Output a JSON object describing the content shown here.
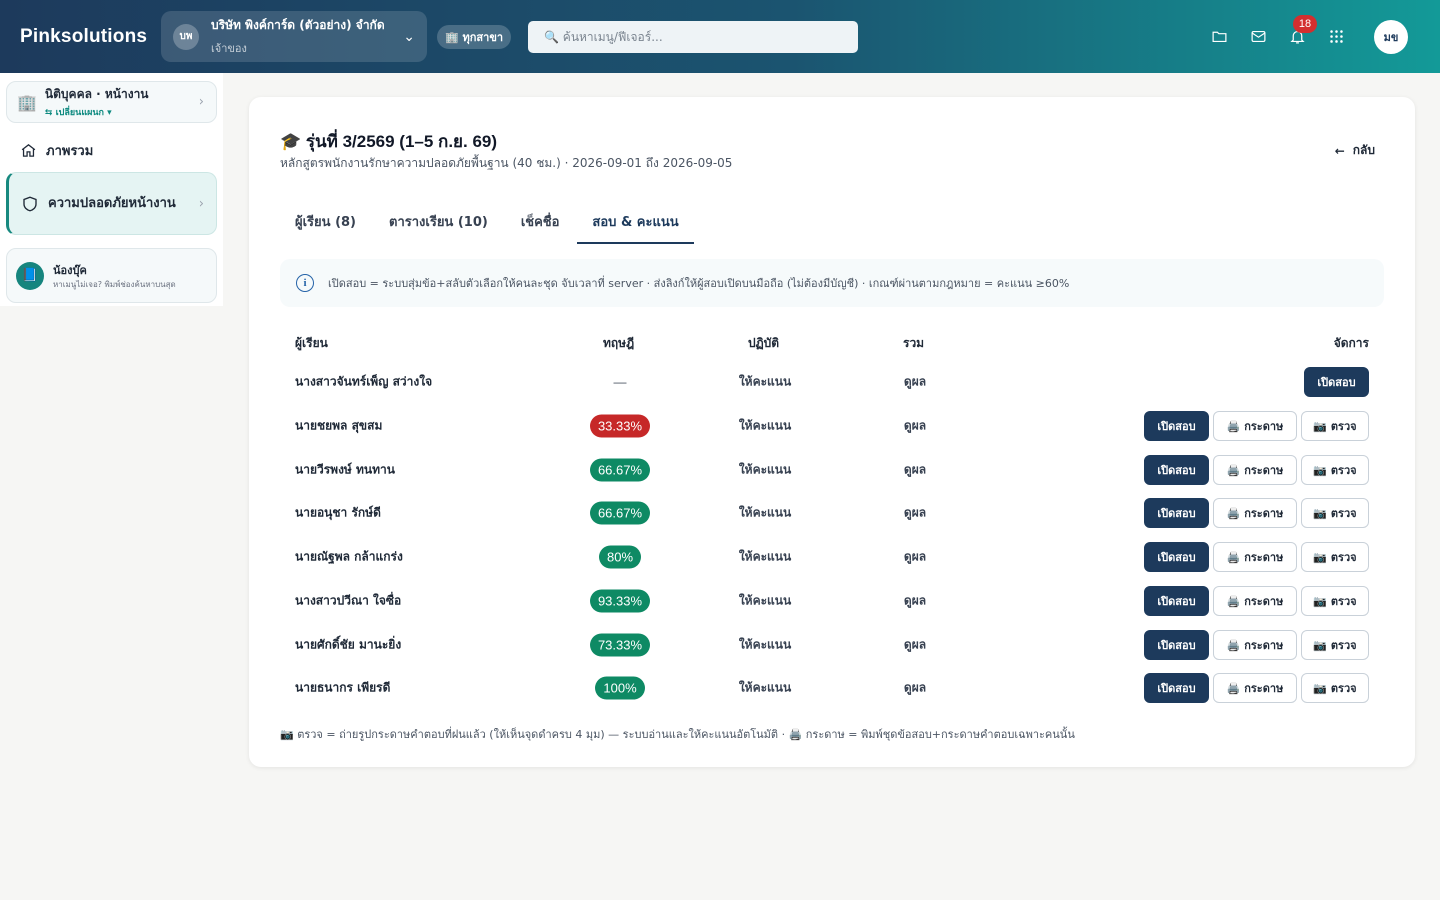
{
  "header": {
    "brand": "Pinksolutions",
    "company_initials": "บพ",
    "company_name": "บริษัท พิงค์การ์ด (ตัวอย่าง) จำกัด",
    "company_role": "เจ้าของ",
    "branch_label": "🏢 ทุกสาขา",
    "search_placeholder": "🔍 ค้นหาเมนู/ฟีเจอร์...",
    "notification_count": "18",
    "user_initials": "มข"
  },
  "sidebar": {
    "org_title": "นิติบุคคล · หน้างาน",
    "org_sub": "⇆ เปลี่ยนแผนก ▾",
    "home_label": "ภาพรวม",
    "active_item": "ความปลอดภัยหน้างาน",
    "helper_title": "น้องบุ๊ค",
    "helper_sub": "หาเมนูไม่เจอ? พิมพ์ช่องค้นหาบนสุด"
  },
  "course": {
    "title": "🎓 รุ่นที่ 3/2569 (1–5 ก.ย. 69)",
    "subtitle": "หลักสูตรพนักงานรักษาความปลอดภัยพื้นฐาน (40 ชม.) · 2026-09-01 ถึง 2026-09-05",
    "back_label": "กลับ"
  },
  "tabs": [
    "ผู้เรียน (8)",
    "ตารางเรียน (10)",
    "เช็คชื่อ",
    "สอบ & คะแนน"
  ],
  "active_tab": 3,
  "info_text": "เปิดสอบ = ระบบสุ่มข้อ+สลับตัวเลือกให้คนละชุด จับเวลาที่ server · ส่งลิงก์ให้ผู้สอบเปิดบนมือถือ (ไม่ต้องมีบัญชี) · เกณฑ์ผ่านตามกฎหมาย = คะแนน ≥60%",
  "table": {
    "headers": {
      "name": "ผู้เรียน",
      "theory": "ทฤษฎี",
      "practice": "ปฏิบัติ",
      "total": "รวม",
      "manage": "จัดการ"
    },
    "rows": [
      {
        "name": "นางสาวจันทร์เพ็ญ สว่างใจ",
        "theory": "—",
        "practice": "ให้คะแนน",
        "total": "ดูผล",
        "status": "none"
      },
      {
        "name": "นายชยพล สุขสม",
        "theory": "33.33%",
        "practice": "ให้คะแนน",
        "total": "ดูผล",
        "status": "fail"
      },
      {
        "name": "นายวีรพงษ์ ทนทาน",
        "theory": "66.67%",
        "practice": "ให้คะแนน",
        "total": "ดูผล",
        "status": "pass"
      },
      {
        "name": "นายอนุชา รักษ์ดี",
        "theory": "66.67%",
        "practice": "ให้คะแนน",
        "total": "ดูผล",
        "status": "pass"
      },
      {
        "name": "นายณัฐพล กล้าแกร่ง",
        "theory": "80%",
        "practice": "ให้คะแนน",
        "total": "ดูผล",
        "status": "pass"
      },
      {
        "name": "นางสาวปวีณา ใจซื่อ",
        "theory": "93.33%",
        "practice": "ให้คะแนน",
        "total": "ดูผล",
        "status": "pass"
      },
      {
        "name": "นายศักดิ์ชัย มานะยิ่ง",
        "theory": "73.33%",
        "practice": "ให้คะแนน",
        "total": "ดูผล",
        "status": "pass"
      },
      {
        "name": "นายธนากร เพียรดี",
        "theory": "100%",
        "practice": "ให้คะแนน",
        "total": "ดูผล",
        "status": "pass"
      }
    ]
  },
  "actions": {
    "open_exam": "เปิดสอบ",
    "paper": "🖨️ กระดาษ",
    "check": "📷 ตรวจ"
  },
  "footer_note": "📷 ตรวจ = ถ่ายรูปกระดาษคำตอบที่ฝนแล้ว (ให้เห็นจุดดำครบ 4 มุม) — ระบบอ่านและให้คะแนนอัตโนมัติ · 🖨️ กระดาษ = พิมพ์ชุดข้อสอบ+กระดาษคำตอบเฉพาะคนนั้น",
  "colors": {
    "primary": "#1d3a5c",
    "accent": "#139a98",
    "pass": "#0e8a64",
    "fail": "#c62828"
  }
}
